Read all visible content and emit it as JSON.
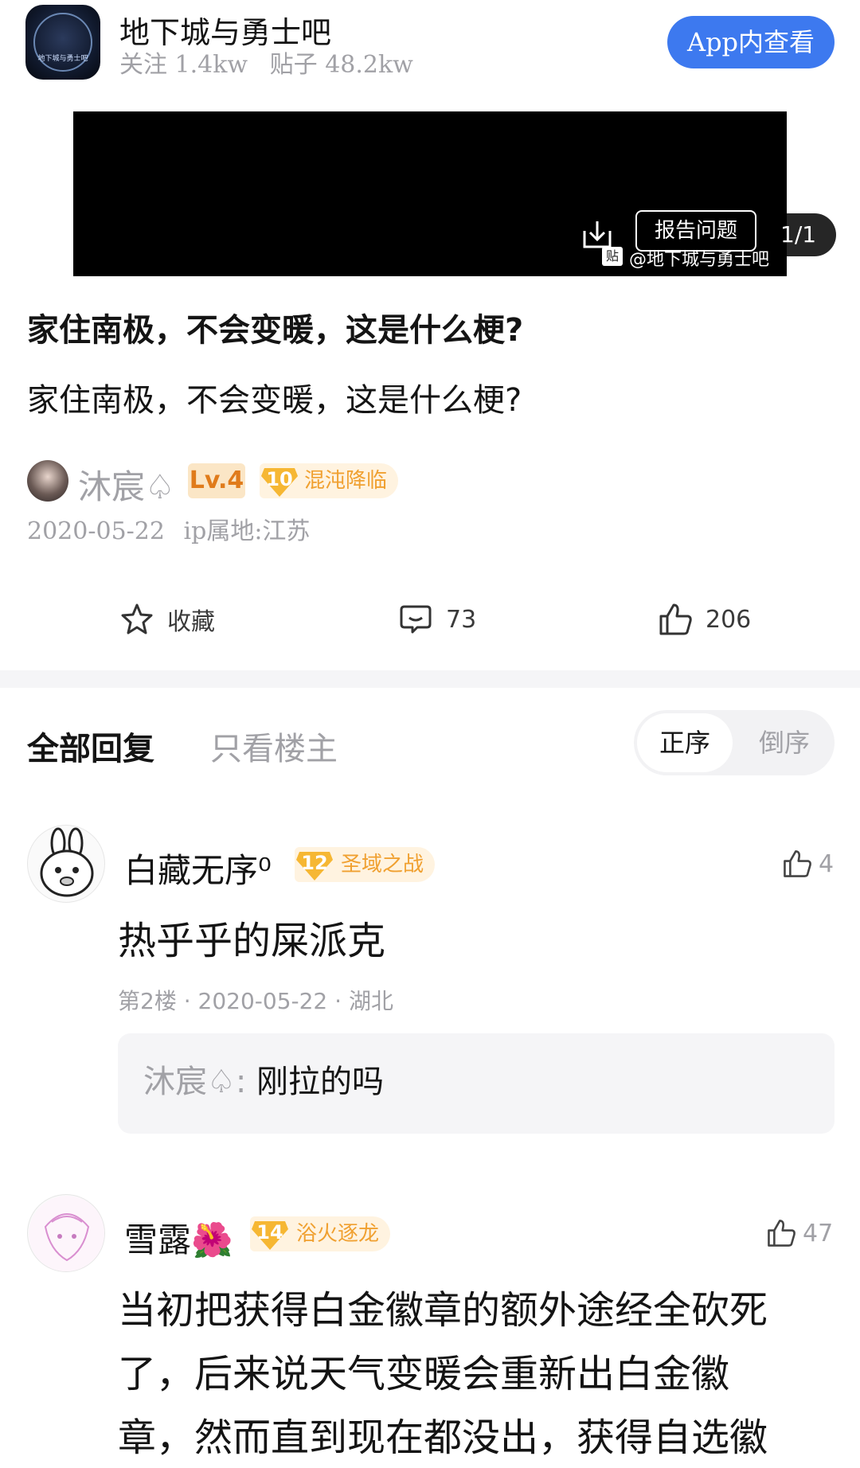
{
  "header": {
    "forum_name": "地下城与勇士吧",
    "followers": "关注 1.4kw",
    "posts": "贴子 48.2kw",
    "app_button": "App内查看",
    "avatar_text": "地下城与勇士吧"
  },
  "media": {
    "report_label": "报告问题",
    "watermark": "@地下城与勇士吧",
    "tie_tag": "贴",
    "page_indicator": "1/1"
  },
  "post": {
    "title": "家住南极，不会变暖，这是什么梗?",
    "body": "家住南极，不会变暖，这是什么梗?",
    "author": "沐宸♤",
    "level": "Lv.4",
    "badge_num": "10",
    "badge_title": "混沌降临",
    "date": "2020-05-22",
    "ip": "ip属地:江苏"
  },
  "actions": {
    "favorite": "收藏",
    "comments": "73",
    "likes": "206"
  },
  "tabs": {
    "all": "全部回复",
    "owner_only": "只看楼主",
    "sort_asc": "正序",
    "sort_desc": "倒序"
  },
  "comments": [
    {
      "name": "白藏无序⁰",
      "badge_num": "12",
      "badge_title": "圣域之战",
      "likes": "4",
      "text": "热乎乎的屎派克",
      "meta": "第2楼 · 2020-05-22 · 湖北",
      "reply": {
        "author": "沐宸♤:",
        "text": "刚拉的吗"
      }
    },
    {
      "name": "雪露🌺",
      "badge_num": "14",
      "badge_title": "浴火逐龙",
      "likes": "47",
      "text_lines": [
        "当初把获得白金徽章的额外途经全砍死",
        "了，后来说天气变暖会重新出白金徽",
        "章，然而直到现在都没出，获得自选徽"
      ]
    }
  ],
  "colors": {
    "accent_blue": "#3d79ef",
    "badge_orange": "#f0a030",
    "muted": "#a1a1a6"
  }
}
